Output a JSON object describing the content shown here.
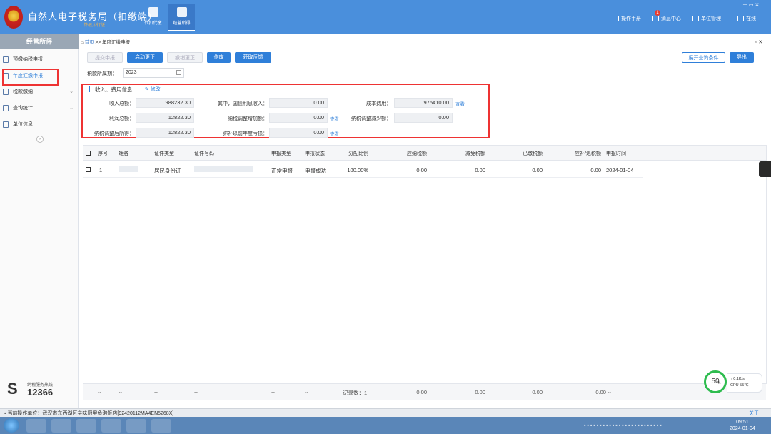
{
  "app": {
    "title": "自然人电子税务局（扣缴端）",
    "subtitle": "芥根太行版"
  },
  "top_nav": [
    {
      "label": "代扣代缴"
    },
    {
      "label": "经营所得"
    }
  ],
  "header_links": {
    "manual": "操作手册",
    "messages": "消息中心",
    "message_count": "1",
    "unit_mgmt": "单位管理",
    "online": "在线"
  },
  "window_controls": "－ ▭ ✕",
  "sidebar": {
    "title": "经营所得",
    "items": [
      {
        "label": "预缴纳税申报"
      },
      {
        "label": "年度汇缴申报"
      },
      {
        "label": "税款缴纳"
      },
      {
        "label": "查询统计"
      },
      {
        "label": "单位信息"
      }
    ],
    "collapse": "«",
    "hotline_label": "纳税服务热线",
    "hotline_number": "12366"
  },
  "breadcrumb": {
    "home": "首页",
    "sep": " >> ",
    "current": "年度汇缴申报"
  },
  "toolbar": {
    "submit": "提交申报",
    "start_correct": "启动更正",
    "cancel_correct": "撤销更正",
    "void": "作废",
    "feedback": "获取反馈",
    "expand_query": "展开查询条件",
    "export": "导出"
  },
  "period": {
    "label": "税款所属期：",
    "value": "2023"
  },
  "income": {
    "title": "收入、费用信息",
    "edit": "修改",
    "view": "查看",
    "total_income_label": "收入总额：",
    "total_income": "988232.30",
    "bond_interest_label": "其中，国债利息收入：",
    "bond_interest": "0.00",
    "cost_label": "成本费用：",
    "cost": "975410.00",
    "profit_label": "利润总额：",
    "profit": "12822.30",
    "adj_inc_label": "纳税调整增加额：",
    "adj_inc": "0.00",
    "adj_dec_label": "纳税调整减少额：",
    "adj_dec": "0.00",
    "adjusted_label": "纳税调整后所得：",
    "adjusted": "12822.30",
    "loss_label": "弥补以前年度亏损：",
    "loss": "0.00"
  },
  "table": {
    "headers": [
      "序号",
      "姓名",
      "证件类型",
      "证件号码",
      "申报类型",
      "申报状态",
      "分配比例",
      "应纳税额",
      "减免税额",
      "已缴税额",
      "应补/退税额",
      "申报时间"
    ],
    "rows": [
      [
        "1",
        "",
        "居民身份证",
        "",
        "正常申报",
        "申报成功",
        "100.00%",
        "0.00",
        "0.00",
        "0.00",
        "0.00",
        "2024-01-04"
      ]
    ],
    "footer": {
      "dash": "--",
      "count": "记录数：1",
      "v1": "0.00",
      "v2": "0.00",
      "v3": "0.00",
      "v4": "0.00 --"
    }
  },
  "status": {
    "unit": "当前操作单位：武汉市东西湖区辛味厨甲鱼泡饭店[92420112MA4EN5268X]",
    "about": "关于"
  },
  "monitor": {
    "percent": "50",
    "pct": "%",
    "speed": "↑ 0.1K/s",
    "cpu": "CPU 55℃"
  },
  "clock": {
    "time": "09:51",
    "date": "2024-01-04"
  },
  "colors": {
    "header": "#4a8fdc",
    "primary": "#2f7fd9",
    "highlight": "#e33333"
  }
}
